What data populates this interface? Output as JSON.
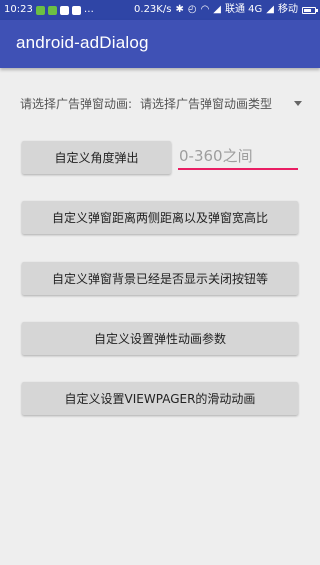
{
  "status_bar": {
    "time": "10:23",
    "speed": "0.23K/s",
    "carrier1": "联通 4G",
    "carrier2": "移动",
    "battery_level": 0.7
  },
  "toolbar": {
    "title": "android-adDialog"
  },
  "spinner": {
    "label": "请选择广告弹窗动画:",
    "value": "请选择广告弹窗动画类型"
  },
  "angle": {
    "button_label": "自定义角度弹出",
    "placeholder": "0-360之间"
  },
  "buttons": [
    {
      "label": "自定义弹窗距离两侧距离以及弹窗宽高比"
    },
    {
      "label": "自定义弹窗背景已经是否显示关闭按钮等"
    },
    {
      "label": "自定义设置弹性动画参数"
    },
    {
      "label": "自定义设置VIEWPAGER的滑动动画"
    }
  ],
  "colors": {
    "primary": "#3f51b5",
    "primary_dark": "#2f45a6",
    "accent": "#e91e63",
    "background": "#eeeeee",
    "button": "#d6d6d6"
  }
}
